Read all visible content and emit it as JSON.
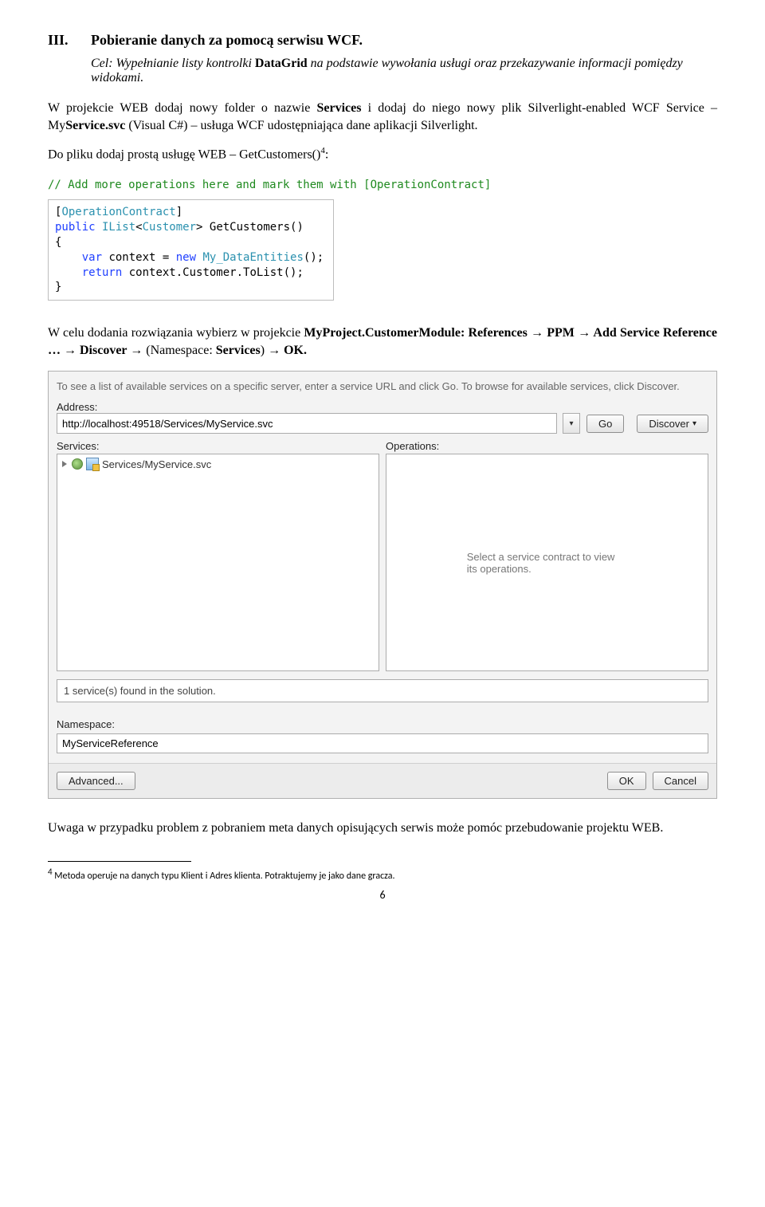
{
  "heading": {
    "num": "III.",
    "title": "Pobieranie danych za pomocą serwisu WCF."
  },
  "cel": {
    "label": "Cel:",
    "text": " Wypełnianie listy kontrolki ",
    "bold1": "DataGrid",
    "text2": " na podstawie wywołania usługi oraz przekazywanie informacji pomiędzy widokami."
  },
  "p1": {
    "t1": "W projekcie WEB dodaj nowy folder o nazwie ",
    "b1": "Services",
    "t2": " i dodaj do niego nowy plik Silverlight-enabled WCF Service – My",
    "b2": "Service.svc",
    "t3": " (Visual C#) – usługa WCF udostępniająca dane aplikacji Silverlight."
  },
  "p2": "Do pliku dodaj prostą usługę WEB – GetCustomers()",
  "p2_sup": "4",
  "p2_colon": ":",
  "code": {
    "comment": "// Add more operations here and mark them with [OperationContract]",
    "l1_a": "[",
    "l1_b": "OperationContract",
    "l1_c": "]",
    "l2_a": "public",
    "l2_b": " IList",
    "l2_c": "<",
    "l2_d": "Customer",
    "l2_e": "> GetCustomers()",
    "l3": "{",
    "l4_a": "    var",
    "l4_b": " context = ",
    "l4_c": "new",
    "l4_d": " My_DataEntities",
    "l4_e": "();",
    "l5_a": "    return",
    "l5_b": " context.Customer.ToList();",
    "l6": "}"
  },
  "p3": {
    "t1": "W celu dodania rozwiązania wybierz w projekcie ",
    "b1": "MyProject.CustomerModule: References → PPM → Add Service Reference … → Discover → ",
    "t2": "(Namespace: ",
    "b2": "Services",
    "t3": ") ",
    "b3": "→ OK."
  },
  "dialog": {
    "desc": "To see a list of available services on a specific server, enter a service URL and click Go. To browse for available services, click Discover.",
    "addressLabel": "Address:",
    "addressValue": "http://localhost:49518/Services/MyService.svc",
    "go": "Go",
    "discover": "Discover",
    "servicesLabel": "Services:",
    "operationsLabel": "Operations:",
    "treeItem": "Services/MyService.svc",
    "opsHint": "Select a service contract to view its operations.",
    "status": "1 service(s) found in the solution.",
    "nsLabel": "Namespace:",
    "nsValue": "MyServiceReference",
    "advanced": "Advanced...",
    "ok": "OK",
    "cancel": "Cancel"
  },
  "p4": "Uwaga w przypadku problem z pobraniem meta danych opisujących serwis może pomóc przebudowanie projektu WEB.",
  "footnote": {
    "sup": "4",
    "text": " Metoda operuje na danych typu Klient i Adres klienta. Potraktujemy je jako dane gracza."
  },
  "pageNum": "6"
}
